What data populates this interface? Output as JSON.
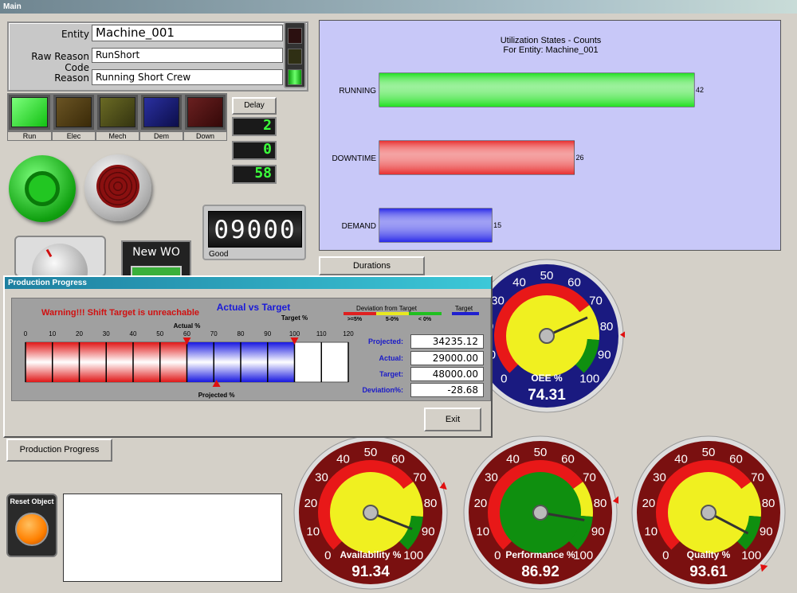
{
  "window": {
    "title": "Main"
  },
  "entity_panel": {
    "entity_label": "Entity",
    "entity_value": "Machine_001",
    "raw_reason_label": "Raw Reason Code",
    "raw_reason_value": "RunShort",
    "reason_label": "Reason",
    "reason_value": "Running Short Crew"
  },
  "state_lamps": [
    {
      "label": "Run",
      "color": "#22e022"
    },
    {
      "label": "Elec",
      "color": "#4a3a12"
    },
    {
      "label": "Mech",
      "color": "#4a4a14"
    },
    {
      "label": "Dem",
      "color": "#14186a"
    },
    {
      "label": "Down",
      "color": "#4a1010"
    }
  ],
  "delay": {
    "label": "Delay",
    "counters": [
      "2",
      "0",
      "58"
    ]
  },
  "counter": {
    "value": "09000",
    "label": "Good"
  },
  "new_wo": {
    "label": "New WO"
  },
  "durations_button": "Durations",
  "production_progress_button": "Production Progress",
  "reset_object_label": "Reset Object",
  "utilization_chart": {
    "title_line1": "Utilization States - Counts",
    "title_line2": "For Entity: Machine_001",
    "colors": {
      "RUNNING": "#22e022",
      "DOWNTIME": "#e83030",
      "DEMAND": "#2a2ae8"
    }
  },
  "chart_data": {
    "type": "bar",
    "orientation": "horizontal",
    "title": "Utilization States - Counts For Entity: Machine_001",
    "categories": [
      "RUNNING",
      "DOWNTIME",
      "DEMAND"
    ],
    "values": [
      42,
      26,
      15
    ]
  },
  "production_dialog": {
    "title": "Production Progress",
    "warning": "Warning!!! Shift Target is unreachable",
    "chart_title": "Actual vs Target",
    "legend_title": "Deviation from Target",
    "legend_items": [
      ">=5%",
      "5-0%",
      "< 0%"
    ],
    "legend_target": "Target",
    "scale_ticks": [
      "0",
      "10",
      "20",
      "30",
      "40",
      "50",
      "60",
      "70",
      "80",
      "90",
      "100",
      "110",
      "120"
    ],
    "scale_max": 120,
    "actual_percent": 60,
    "projected_percent": 71,
    "target_percent": 100,
    "actual_marker_label": "Actual %",
    "target_marker_label": "Target %",
    "projected_marker_label": "Projected %",
    "projected_label": "Projected:",
    "projected_value": "34235.12",
    "actual_label": "Actual:",
    "actual_value": "29000.00",
    "target_label": "Target:",
    "target_value": "48000.00",
    "deviation_label": "Deviation%:",
    "deviation_value": "-28.68",
    "exit_label": "Exit"
  },
  "gauges": [
    {
      "id": "oee",
      "label": "OEE %",
      "display": "74.31",
      "value": 74.31,
      "target": 83
    },
    {
      "id": "availability",
      "label": "Availability %",
      "display": "91.34",
      "value": 91.34,
      "target": 76
    },
    {
      "id": "performance",
      "label": "Performance %",
      "display": "86.92",
      "value": 86.92,
      "target": 80
    },
    {
      "id": "quality",
      "label": "Quality %",
      "display": "93.61",
      "value": 93.61,
      "target": 100
    }
  ],
  "gauge_ticks": [
    "0",
    "10",
    "20",
    "30",
    "40",
    "50",
    "60",
    "70",
    "80",
    "90",
    "100"
  ]
}
